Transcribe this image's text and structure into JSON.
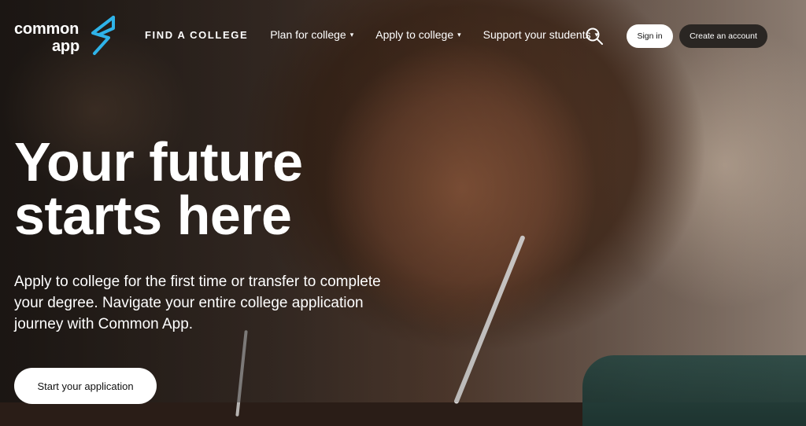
{
  "brand": {
    "logo_line1": "common",
    "logo_line2": "app",
    "accent_color": "#2fb3e8"
  },
  "nav": {
    "find_college": "FIND A COLLEGE",
    "plan": "Plan for college",
    "apply": "Apply to college",
    "support": "Support your students",
    "caret": "▾"
  },
  "icons": {
    "search": "search-icon",
    "logo_mark": "common-app-logo-mark"
  },
  "auth": {
    "sign_in": "Sign in",
    "create_account": "Create an account"
  },
  "hero": {
    "title_line1": "Your future",
    "title_line2": "starts here",
    "subtitle": "Apply to college for the first time or transfer to complete your degree. Navigate your entire college application journey with Common App.",
    "cta": "Start your application"
  }
}
